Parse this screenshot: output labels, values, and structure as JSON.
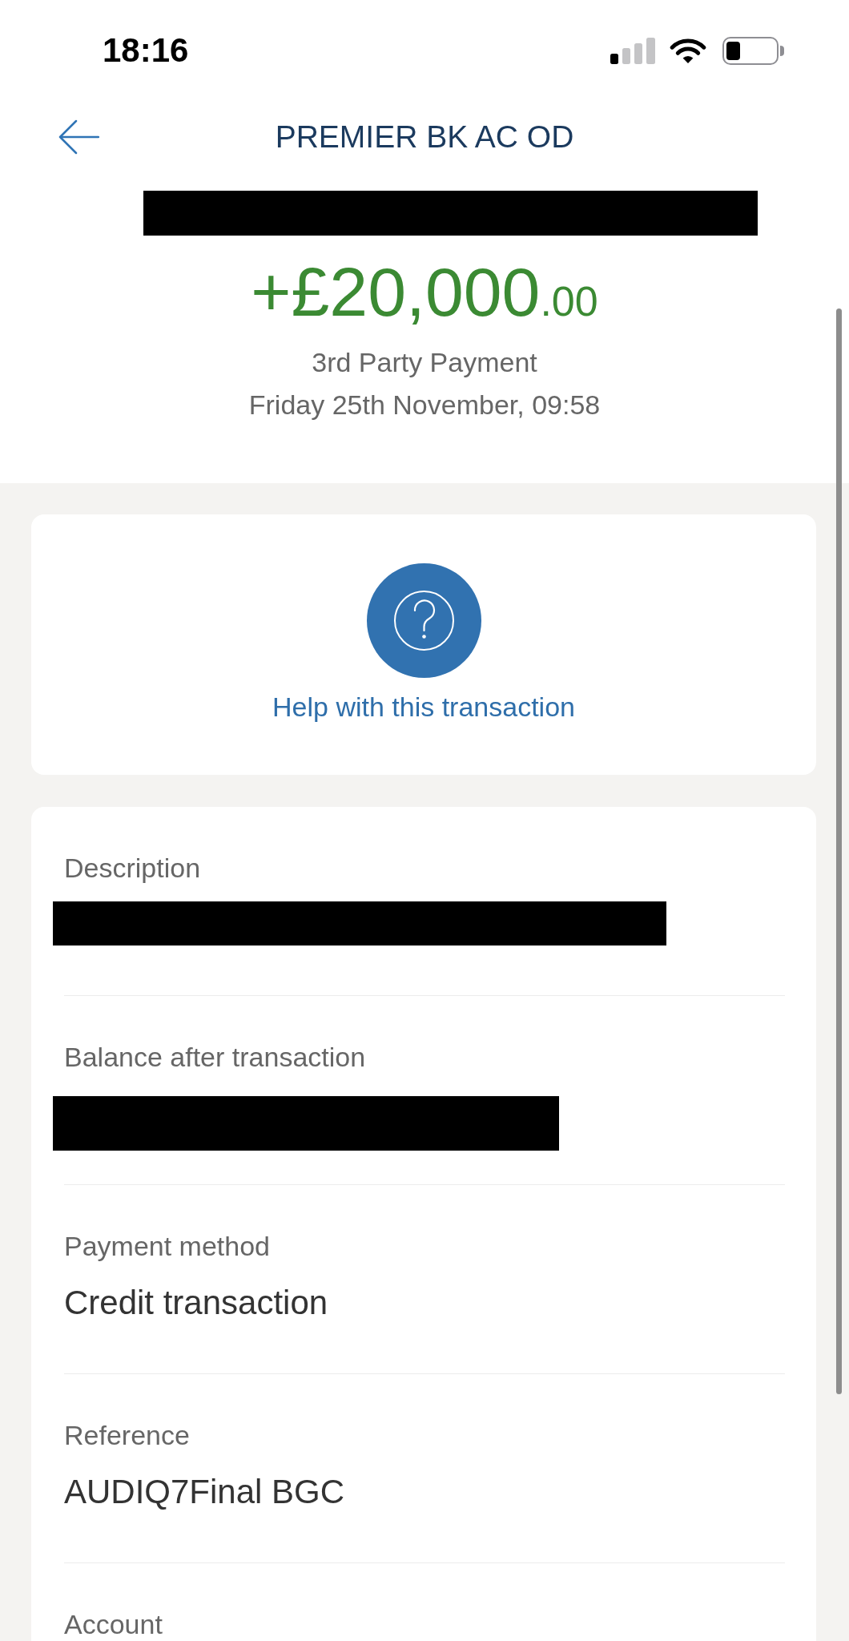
{
  "status_bar": {
    "time": "18:16"
  },
  "header": {
    "title": "PREMIER BK AC OD",
    "redacted": true
  },
  "transaction": {
    "amount": "+£20,000",
    "amount_pence": ".00",
    "type": "3rd Party Payment",
    "date": "Friday 25th November, 09:58"
  },
  "help": {
    "label": "Help with this transaction"
  },
  "details": [
    {
      "label": "Description",
      "redacted": true
    },
    {
      "label": "Balance after transaction",
      "redacted": true
    },
    {
      "label": "Payment method",
      "redacted": false,
      "value": "Credit transaction"
    },
    {
      "label": "Reference",
      "redacted": false,
      "value": "AUDIQ7Final BGC"
    },
    {
      "label": "Account"
    }
  ]
}
